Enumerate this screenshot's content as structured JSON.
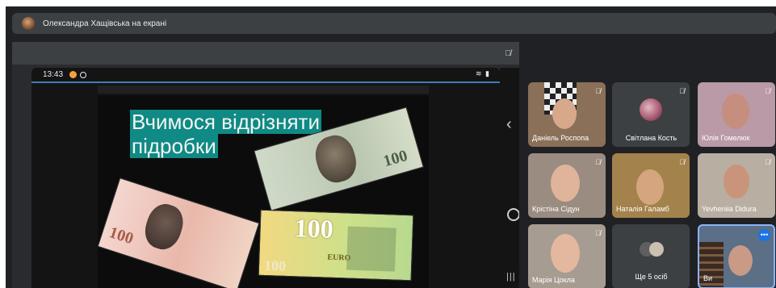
{
  "header": {
    "presenter_label": "Олександра Хащівська на екрані"
  },
  "phone": {
    "time": "13:43",
    "status_icons": "≋ ▮"
  },
  "slide": {
    "title_line1": "Вчимося відрізняти",
    "title_line2": "підробки"
  },
  "banknotes": {
    "uah_value": "100",
    "usd_value": "100",
    "eur_value": "100",
    "eur_value_small": "100",
    "euro_text": "EURO"
  },
  "nav_buttons": {
    "back": "‹",
    "recents": "|||"
  },
  "icons": {
    "mic_off": "mic-off-icon",
    "more": "more-options-icon"
  },
  "participants": [
    {
      "name": "Даніель Роспопа"
    },
    {
      "name": "Світлана Кость"
    },
    {
      "name": "Юлія Гомелюк"
    },
    {
      "name": "Крістіна Сідун"
    },
    {
      "name": "Наталія Галамб"
    },
    {
      "name": "Yevheniia Didura"
    },
    {
      "name": "Марія Цокла"
    },
    {
      "name": "Ще 5 осіб"
    },
    {
      "name": "Ви"
    }
  ],
  "colors": {
    "accent": "#1a73e8",
    "slide_title_bg": "#0f8a84",
    "app_bg": "#202124"
  }
}
